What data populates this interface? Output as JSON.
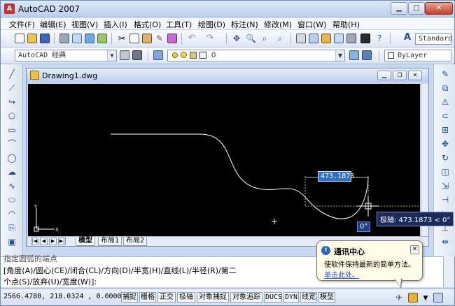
{
  "window": {
    "title": "AutoCAD 2007",
    "min_glyph": "▁",
    "max_glyph": "□",
    "close_glyph": "✕"
  },
  "menu": [
    "文件(F)",
    "编辑(E)",
    "视图(V)",
    "插入(I)",
    "格式(O)",
    "工具(T)",
    "绘图(D)",
    "标注(N)",
    "修改(M)",
    "窗口(W)",
    "帮助(H)"
  ],
  "toolbar": {
    "text_style": "Standard",
    "workspace": "AutoCAD 经典",
    "layer": "0",
    "linetype": "ByLayer"
  },
  "drawing_window": {
    "title": "Drawing1.dwg",
    "tabs": [
      "模型",
      "布局1",
      "布局2"
    ],
    "dynamic_length": "473.1873",
    "dynamic_angle": "0°",
    "polar_tooltip": "极轴: 473.1873 < 0°",
    "ucs_x": "X",
    "ucs_y": "Y",
    "colors": {
      "canvas": "#000000",
      "curve": "#ffffff",
      "dynamic_input": "#2f6fd0"
    }
  },
  "command": {
    "line1": "指定圆弧的端点",
    "line2": "[角度(A)/圆心(CE)/闭合(CL)/方向(D)/半宽(H)/直线(L)/半径(R)/第二",
    "line3": "个点(S)/放弃(U)/宽度(W)]:"
  },
  "status": {
    "coords": "2566.4780, 218.0324 , 0.0000",
    "buttons": [
      "捕捉",
      "栅格",
      "正交",
      "极轴",
      "对象捕捉",
      "对象追踪",
      "DUCS",
      "DYN",
      "线宽",
      "模型"
    ]
  },
  "balloon": {
    "title": "通讯中心",
    "text": "使软件保持最新的简单方法。",
    "link": "单击此处。",
    "close_glyph": "✕"
  }
}
